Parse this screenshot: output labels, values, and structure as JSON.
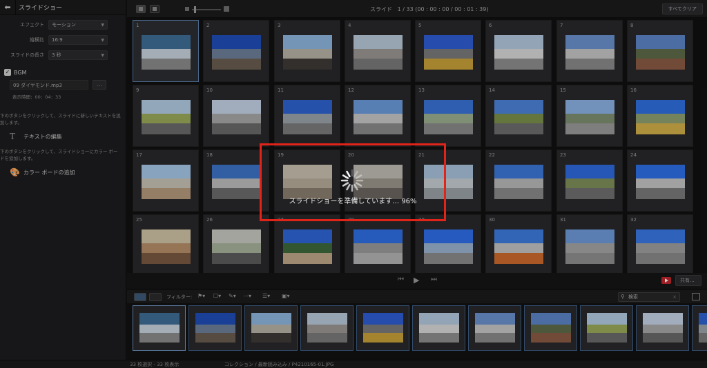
{
  "sidebar": {
    "title": "スライドショー",
    "effect": {
      "label": "エフェクト",
      "value": "モーション"
    },
    "aspect": {
      "label": "縦横比",
      "value": "16:9"
    },
    "duration": {
      "label": "スライドの長さ",
      "value": "3 秒"
    },
    "bgm": {
      "label": "BGM",
      "file": "09 ダイヤモンド.mp3",
      "more": "…",
      "time": "表示時間：00：04：33"
    },
    "help1": "下のボタンをクリックして、スライドに新しいテキストを追加します。",
    "add_text": "テキストの編集",
    "help2": "下のボタンをクリックして、スライドショーにカラー ボードを追加します。",
    "add_board": "カラー ボードの追加"
  },
  "topbar": {
    "slide_label": "スライド",
    "slide_info": "1 / 33 (00 : 00 : 00 / 00 : 01 : 39)",
    "clear_all": "すべてクリア"
  },
  "grid": {
    "tiles": [
      {
        "n": "1",
        "c": [
          "#3f6d96",
          "#c8d3df",
          "#8b8b8b"
        ]
      },
      {
        "n": "2",
        "c": [
          "#1f4fb8",
          "#6d7f99",
          "#6a5d50"
        ]
      },
      {
        "n": "3",
        "c": [
          "#8fb6e0",
          "#b9b3a5",
          "#3d3a38"
        ]
      },
      {
        "n": "4",
        "c": [
          "#b9c8d8",
          "#9b9793",
          "#7b7b7b"
        ]
      },
      {
        "n": "5",
        "c": [
          "#2f5fd4",
          "#7a7a7a",
          "#c9a23a"
        ]
      },
      {
        "n": "6",
        "c": [
          "#b3c9df",
          "#d8d8d8",
          "#8e8e8e"
        ]
      },
      {
        "n": "7",
        "c": [
          "#6a92cc",
          "#c6c6c6",
          "#8a8a8a"
        ]
      },
      {
        "n": "8",
        "c": [
          "#5d86c9",
          "#5d6b4a",
          "#8b5b45"
        ]
      },
      {
        "n": "9",
        "c": [
          "#b4cce4",
          "#9aaa5a",
          "#6b6b6b"
        ]
      },
      {
        "n": "10",
        "c": [
          "#c5d4e6",
          "#a8a8a8",
          "#6a6a6a"
        ]
      },
      {
        "n": "11",
        "c": [
          "#2e63d1",
          "#9ca4aa",
          "#7c7c7c"
        ]
      },
      {
        "n": "12",
        "c": [
          "#6b9bdc",
          "#c7c7c7",
          "#8a8a8a"
        ]
      },
      {
        "n": "13",
        "c": [
          "#3a73d8",
          "#9aaf8f",
          "#8a8a8a"
        ]
      },
      {
        "n": "14",
        "c": [
          "#4c83d8",
          "#7a8f4b",
          "#6d6d6d"
        ]
      },
      {
        "n": "15",
        "c": [
          "#8cb3e4",
          "#7d8f6f",
          "#9a9a9a"
        ]
      },
      {
        "n": "16",
        "c": [
          "#2f6fe0",
          "#8ea071",
          "#d3b049"
        ]
      },
      {
        "n": "17",
        "c": [
          "#a7c7e8",
          "#c9c2b6",
          "#b59a7c"
        ]
      },
      {
        "n": "18",
        "c": [
          "#3d74c9",
          "#bdbdbd",
          "#6c6c6c"
        ]
      },
      {
        "n": "19",
        "c": [
          "#c8c0b0",
          "#b7ad9a",
          "#8a7f70"
        ]
      },
      {
        "n": "20",
        "c": [
          "#c0bcb4",
          "#9b968d",
          "#6c6660"
        ]
      },
      {
        "n": "21",
        "c": [
          "#a9c3db",
          "#c6cdd2",
          "#9aa1a6"
        ]
      },
      {
        "n": "22",
        "c": [
          "#3c78d8",
          "#b9b9b9",
          "#8a8a8a"
        ]
      },
      {
        "n": "23",
        "c": [
          "#2f6be0",
          "#7f8f5a",
          "#6f6f6f"
        ]
      },
      {
        "n": "24",
        "c": [
          "#2f6fe8",
          "#c5c5c5",
          "#7a7a7a"
        ]
      },
      {
        "n": "25",
        "c": [
          "#d0c2a5",
          "#b88f6a",
          "#7a5a43"
        ]
      },
      {
        "n": "26",
        "c": [
          "#c7c9c0",
          "#a7b39a",
          "#5c5c5c"
        ]
      },
      {
        "n": "27",
        "c": [
          "#2f66d6",
          "#3e6a3a",
          "#bfa888"
        ]
      },
      {
        "n": "28",
        "c": [
          "#2f6fe6",
          "#9a9a9a",
          "#b4b4b4"
        ]
      },
      {
        "n": "29",
        "c": [
          "#2f6ee8",
          "#9ab2cf",
          "#8c8c8c"
        ]
      },
      {
        "n": "30",
        "c": [
          "#3f7ce0",
          "#c3c3c3",
          "#cf6b2e"
        ]
      },
      {
        "n": "31",
        "c": [
          "#6e9ad8",
          "#a5a5a5",
          "#8f8f8f"
        ]
      },
      {
        "n": "32",
        "c": [
          "#3a78e4",
          "#9f9f9f",
          "#8a8a8a"
        ]
      }
    ]
  },
  "loading": {
    "text": "スライドショーを準備しています… 96%",
    "percent": 96,
    "highlight": "#e1241a"
  },
  "stripbar": {
    "filter": "フィルター:",
    "search_placeholder": "検索"
  },
  "strip": {
    "thumbs": [
      {
        "c": [
          "#3f6d96",
          "#c8d3df",
          "#8b8b8b"
        ]
      },
      {
        "c": [
          "#1f4fb8",
          "#6d7f99",
          "#6a5d50"
        ]
      },
      {
        "c": [
          "#8fb6e0",
          "#b9b3a5",
          "#3d3a38"
        ]
      },
      {
        "c": [
          "#b9c8d8",
          "#9b9793",
          "#7b7b7b"
        ]
      },
      {
        "c": [
          "#2f5fd4",
          "#7a7a7a",
          "#c9a23a"
        ]
      },
      {
        "c": [
          "#b3c9df",
          "#d8d8d8",
          "#8e8e8e"
        ]
      },
      {
        "c": [
          "#6a92cc",
          "#c6c6c6",
          "#8a8a8a"
        ]
      },
      {
        "c": [
          "#5d86c9",
          "#5d6b4a",
          "#8b5b45"
        ]
      },
      {
        "c": [
          "#b4cce4",
          "#9aaa5a",
          "#6b6b6b"
        ]
      },
      {
        "c": [
          "#c5d4e6",
          "#a8a8a8",
          "#6a6a6a"
        ]
      },
      {
        "c": [
          "#2e63d1",
          "#9ca4aa",
          "#7c7c7c"
        ]
      }
    ]
  },
  "playbar": {
    "share": "共有..."
  },
  "status": {
    "left": "33 枚選択 - 33 枚表示",
    "path": "コレクション / 最新読み込み / P4210165-01.JPG"
  }
}
